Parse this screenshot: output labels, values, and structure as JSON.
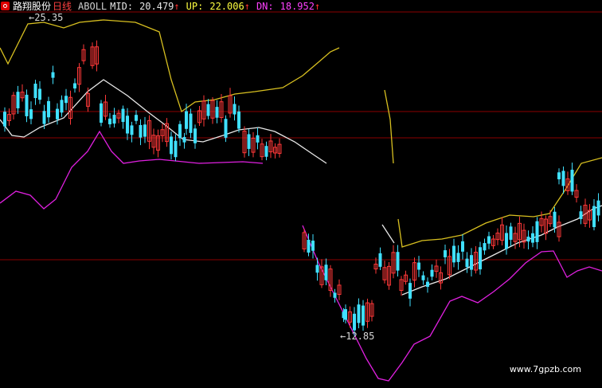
{
  "header": {
    "stock_name": "路翔股份",
    "period": "日线",
    "indicator": "ABOLL",
    "mid_label": "MID:",
    "mid_value": "20.479",
    "up_label": "UP:",
    "up_value": "22.006",
    "dn_label": "DN:",
    "dn_value": "18.952",
    "arrow": "↑"
  },
  "annotations": {
    "max_label": "25.35",
    "min_label": "12.85"
  },
  "watermark": "www.7gpzb.com",
  "colors": {
    "background": "#000000",
    "rise": "#ff3838",
    "fall": "#40e0ff",
    "mid": "#e8e8e8",
    "up": "#d8c020",
    "dn": "#e020e0",
    "gridline": "#8b0000"
  },
  "chart_data": {
    "type": "candlestick",
    "indicator": "ABOLL",
    "series": [
      {
        "name": "MID",
        "value": 20.479
      },
      {
        "name": "UP",
        "value": 22.006
      },
      {
        "name": "DN",
        "value": 18.952
      }
    ],
    "highest": 25.35,
    "lowest": 12.85
  }
}
